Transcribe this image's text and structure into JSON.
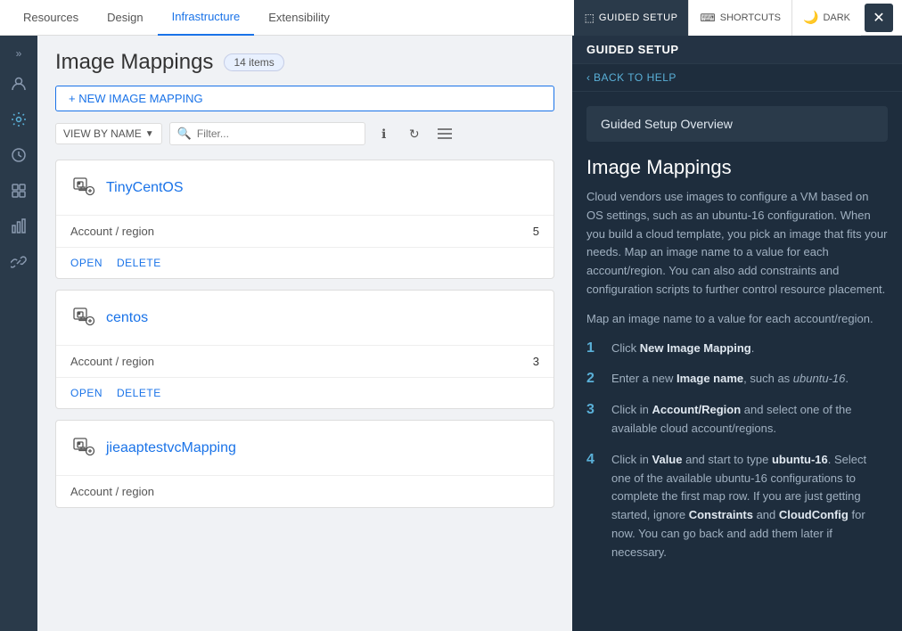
{
  "topNav": {
    "items": [
      {
        "label": "Resources",
        "active": false
      },
      {
        "label": "Design",
        "active": false
      },
      {
        "label": "Infrastructure",
        "active": true
      },
      {
        "label": "Extensibility",
        "active": false
      }
    ],
    "guidedSetup": {
      "label": "GUIDED SETUP",
      "shortcuts": "SHORTCUTS",
      "dark": "DARK"
    }
  },
  "sidebar": {
    "expandIcon": "»",
    "icons": [
      "👤",
      "⚙",
      "🕐",
      "⬛",
      "📊",
      "🔗"
    ]
  },
  "page": {
    "title": "Image Mappings",
    "itemsBadge": "14 items",
    "newButtonLabel": "+ NEW IMAGE MAPPING",
    "viewByLabel": "VIEW BY NAME",
    "searchPlaceholder": "Filter..."
  },
  "cards": [
    {
      "name": "TinyCentOS",
      "metaLabel": "Account / region",
      "metaValue": "5",
      "actions": [
        "OPEN",
        "DELETE"
      ]
    },
    {
      "name": "centos",
      "metaLabel": "Account / region",
      "metaValue": "3",
      "actions": [
        "OPEN",
        "DELETE"
      ]
    },
    {
      "name": "jieaaptestvcMapping",
      "metaLabel": "Account / region",
      "metaValue": "",
      "actions": []
    }
  ],
  "guidedPanel": {
    "title": "GUIDED SETUP",
    "backLabel": "BACK TO HELP",
    "sectionTitle": "Guided Setup Overview",
    "mainTitle": "Image Mappings",
    "description": "Cloud vendors use images to configure a VM based on OS settings, such as an ubuntu-16 configuration. When you build a cloud template, you pick an image that fits your needs. Map an image name to a value for each account/region. You can also add constraints and configuration scripts to further control resource placement.",
    "subDesc": "Map an image name to a value for each account/region.",
    "steps": [
      {
        "num": "1",
        "text": "Click <strong>New Image Mapping</strong>."
      },
      {
        "num": "2",
        "text": "Enter a new <strong>Image name</strong>, such as <em>ubuntu-16</em>."
      },
      {
        "num": "3",
        "text": "Click in <strong>Account/Region</strong> and select one of the available cloud account/regions."
      },
      {
        "num": "4",
        "text": "Click in <strong>Value</strong> and start to type <strong>ubuntu-16</strong>. Select one of the available ubuntu-16 configurations to complete the first map row. If you are just getting started, ignore <strong>Constraints</strong> and <strong>CloudConfig</strong> for now. You can go back and add them later if necessary."
      }
    ]
  }
}
